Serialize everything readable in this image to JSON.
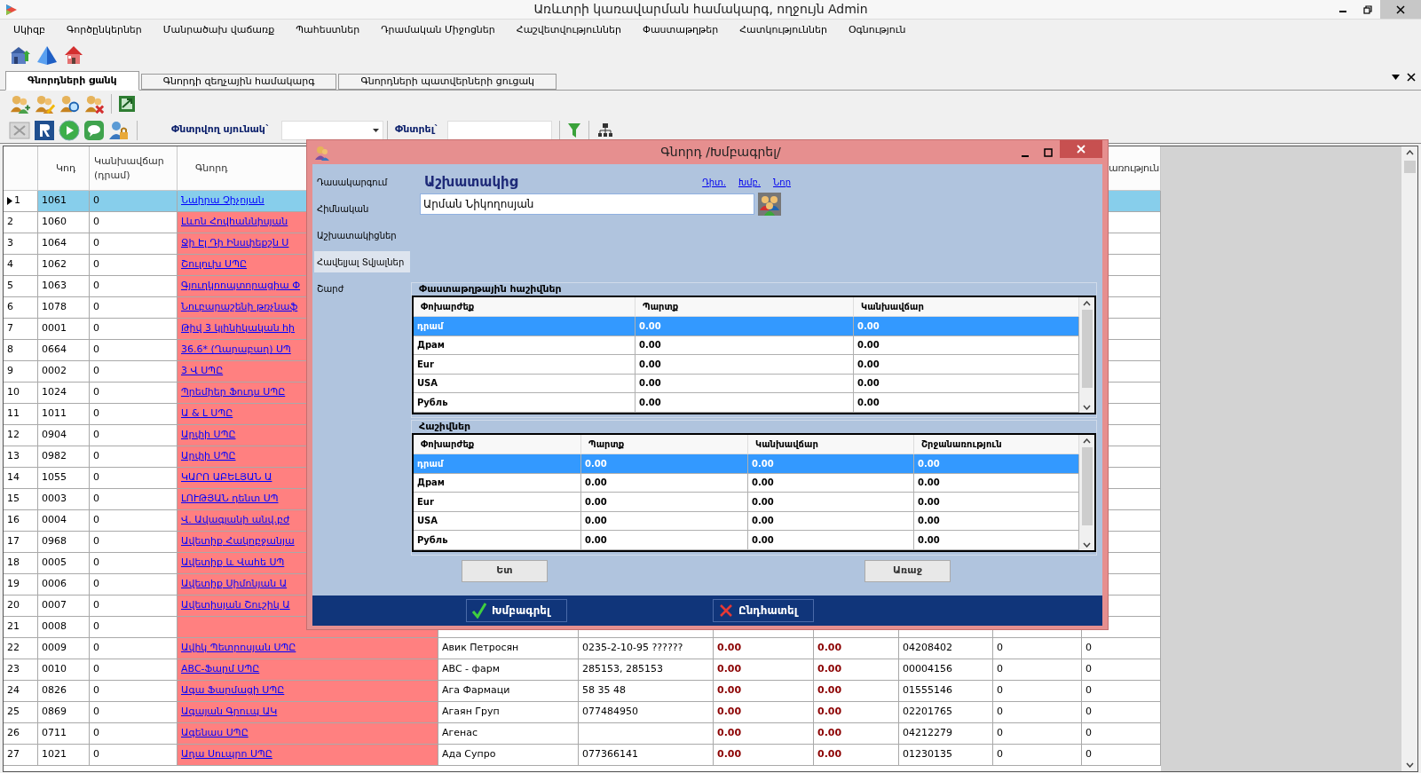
{
  "window": {
    "title": "Առևտրի կառավարման համակարգ, ողջույն Admin"
  },
  "menu": [
    "Սկիզբ",
    "Գործընկերներ",
    "Մանրածախ վաճառք",
    "Պահեստներ",
    "Դրամական Միջոցներ",
    "Հաշվետվություններ",
    "Փաստաթղթեր",
    "Հատկություններ",
    "Օգնություն"
  ],
  "tabs": [
    {
      "label": "Գնորդների ցանկ",
      "selected": true
    },
    {
      "label": "Գնորդի զեղչային համակարգ",
      "selected": false
    },
    {
      "label": "Գնորդների պատվերների ցուցակ",
      "selected": false
    }
  ],
  "search": {
    "column_label": "Փնտրվող սյունակ`",
    "search_label": "Փնտրել`"
  },
  "table": {
    "headers": {
      "code": "Կոդ",
      "advance": "Կանխավճար (դրամ)",
      "customer": "Գնորդ",
      "column_11": "առություն"
    },
    "rows": [
      {
        "number": "1",
        "code": "1061",
        "advance": "0",
        "name": "Նաիրա Չիչոյան",
        "selected": true
      },
      {
        "number": "2",
        "code": "1060",
        "advance": "0",
        "name": "Լևոն Հովհաննիսյան",
        "selected": false
      },
      {
        "number": "3",
        "code": "1064",
        "advance": "0",
        "name": "Ջի Էլ Դի Ինսփեքշն Ս",
        "selected": false
      },
      {
        "number": "4",
        "code": "1062",
        "advance": "0",
        "name": "Շուլուխ ՍՊԸ",
        "selected": false
      },
      {
        "number": "5",
        "code": "1063",
        "advance": "0",
        "name": "Գյուղկոոպտորացիա Փ",
        "selected": false
      },
      {
        "number": "6",
        "code": "1078",
        "advance": "0",
        "name": "Նուբարաշենի թռչնաֆ",
        "selected": false
      },
      {
        "number": "7",
        "code": "0001",
        "advance": "0",
        "name": "Թիվ 3 կլինիկական հի",
        "selected": false
      },
      {
        "number": "8",
        "code": "0664",
        "advance": "0",
        "name": "36.6* (Ղարաբաղ) ՍՊ",
        "selected": false
      },
      {
        "number": "9",
        "code": "0002",
        "advance": "0",
        "name": "3 Վ ՍՊԸ",
        "selected": false
      },
      {
        "number": "10",
        "code": "1024",
        "advance": "0",
        "name": "Պրեմիեր Ֆուդս ՍՊԸ",
        "selected": false
      },
      {
        "number": "11",
        "code": "1011",
        "advance": "0",
        "name": "Ա & Լ ՍՊԸ",
        "selected": false
      },
      {
        "number": "12",
        "code": "0904",
        "advance": "0",
        "name": "Արփի ՍՊԸ",
        "selected": false
      },
      {
        "number": "13",
        "code": "0982",
        "advance": "0",
        "name": "Արփի ՍՊԸ",
        "selected": false
      },
      {
        "number": "14",
        "code": "1055",
        "advance": "0",
        "name": "ԿԱՐՈ ԱԲԵԼՅԱՆ Ա",
        "selected": false
      },
      {
        "number": "15",
        "code": "0003",
        "advance": "0",
        "name": "ԼՈՒԹՅԱՆ դենտ ՍՊ",
        "selected": false
      },
      {
        "number": "16",
        "code": "0004",
        "advance": "0",
        "name": "Վ. Ավագյանի անվ.բժ",
        "selected": false
      },
      {
        "number": "17",
        "code": "0968",
        "advance": "0",
        "name": "Ավետիք Հակոբջանյա",
        "selected": false
      },
      {
        "number": "18",
        "code": "0005",
        "advance": "0",
        "name": "Ավետիք և Վահե ՍՊ",
        "selected": false
      },
      {
        "number": "19",
        "code": "0006",
        "advance": "0",
        "name": "Ավետիք Սիմոնյան Ա",
        "selected": false
      },
      {
        "number": "20",
        "code": "0007",
        "advance": "0",
        "name": "Ավետիսյան Շուշիկ Ա",
        "selected": false
      },
      {
        "number": "21",
        "code": "0008",
        "advance": "0",
        "selected": false
      },
      {
        "number": "22",
        "code": "0009",
        "advance": "0",
        "name": "Ավիկ Պետրոսյան ՍՊԸ",
        "column_5": "Авик Петросян",
        "column_6": "0235-2-10-95 ??????",
        "column_7": "0.00",
        "column_8": "0.00",
        "column_9": "04208402",
        "column_10": "0",
        "column_11": "0",
        "selected": false
      },
      {
        "number": "23",
        "code": "0010",
        "advance": "0",
        "name": "ABC-Ֆարմ ՍՊԸ",
        "column_5": "ABC - фарм",
        "column_6": "285153, 285153",
        "column_7": "0.00",
        "column_8": "0.00",
        "column_9": "00004156",
        "column_10": "0",
        "column_11": "0",
        "selected": false
      },
      {
        "number": "24",
        "code": "0826",
        "advance": "0",
        "name": "Ագա Ֆարմացի ՍՊԸ",
        "column_5": "Ага Фармаци",
        "column_6": "58 35 48",
        "column_7": "0.00",
        "column_8": "0.00",
        "column_9": "01555146",
        "column_10": "0",
        "column_11": "0",
        "selected": false
      },
      {
        "number": "25",
        "code": "0869",
        "advance": "0",
        "name": "Ագայան Գրուպ ԱԿ",
        "column_5": "Агаян Груп",
        "column_6": "077484950",
        "column_7": "0.00",
        "column_8": "0.00",
        "column_9": "02201765",
        "column_10": "0",
        "column_11": "0",
        "selected": false
      },
      {
        "number": "26",
        "code": "0711",
        "advance": "0",
        "name": "Ագենաս ՍՊԸ",
        "column_5": "Агенас",
        "column_7": "0.00",
        "column_8": "0.00",
        "column_9": "04212279",
        "column_10": "0",
        "column_11": "0",
        "selected": false
      },
      {
        "number": "27",
        "code": "1021",
        "advance": "0",
        "name": "Ադա Սուպրո ՍՊԸ",
        "column_5": "Ада Супро",
        "column_6": "077366141",
        "column_7": "0.00",
        "column_8": "0.00",
        "column_9": "01230135",
        "column_10": "0",
        "column_11": "0",
        "selected": false
      }
    ]
  },
  "dialog": {
    "title": "Գնորդ /Խմբագրել/",
    "nav": [
      {
        "label": "Դասակարգում",
        "selected": false
      },
      {
        "label": "Հիմնական",
        "selected": false
      },
      {
        "label": "Աշխատակիցներ",
        "selected": false
      },
      {
        "label": "Հավելյալ Տվյալներ",
        "selected": true
      },
      {
        "label": "Շարժ",
        "selected": false
      }
    ],
    "section_title": "Աշխատակից",
    "links": [
      "Դիտ.",
      "Խմբ.",
      "Նոր"
    ],
    "employee": {
      "value": "Արման Նիկողոսյան"
    },
    "document_accounts": {
      "title": "Փաստաթղթային հաշիվներ",
      "columns": [
        "Փոխարժեք",
        "Պարտք",
        "Կանխավճար"
      ],
      "rows": [
        {
          "cells": [
            "դրամ",
            "0.00",
            "0.00"
          ],
          "selected": true
        },
        {
          "cells": [
            "Драм",
            "0.00",
            "0.00"
          ],
          "selected": false
        },
        {
          "cells": [
            "Eur",
            "0.00",
            "0.00"
          ],
          "selected": false
        },
        {
          "cells": [
            "USA",
            "0.00",
            "0.00"
          ],
          "selected": false
        },
        {
          "cells": [
            "Рубль",
            "0.00",
            "0.00"
          ],
          "selected": false
        }
      ]
    },
    "accounts": {
      "title": "Հաշիվներ",
      "columns": [
        "Փոխարժեք",
        "Պարտք",
        "Կանխավճար",
        "Շրջանառություն"
      ],
      "rows": [
        {
          "cells": [
            "դրամ",
            "0.00",
            "0.00",
            "0.00"
          ],
          "selected": true
        },
        {
          "cells": [
            "Драм",
            "0.00",
            "0.00",
            "0.00"
          ],
          "selected": false
        },
        {
          "cells": [
            "Eur",
            "0.00",
            "0.00",
            "0.00"
          ],
          "selected": false
        },
        {
          "cells": [
            "USA",
            "0.00",
            "0.00",
            "0.00"
          ],
          "selected": false
        },
        {
          "cells": [
            "Рубль",
            "0.00",
            "0.00",
            "0.00"
          ],
          "selected": false
        }
      ]
    },
    "back_button": "Ետ",
    "forward_button": "Առաջ",
    "edit_button": "Խմբագրել",
    "cancel_button": "Ընդհատել"
  }
}
